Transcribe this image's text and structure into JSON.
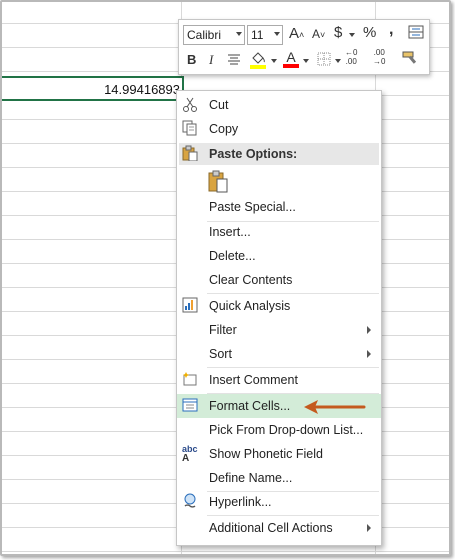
{
  "cell": {
    "value": "14.99416893"
  },
  "toolbar": {
    "font_name": "Calibri",
    "font_size": "11",
    "grow_font": "A",
    "shrink_font": "A",
    "currency": "$",
    "percent": "%",
    "comma": ",",
    "bold": "B",
    "italic": "I",
    "font_color_letter": "A",
    "font_color": "#ff0000",
    "fill_color": "#ffff00",
    "increase_decimal": ".00",
    "decrease_decimal": ".00"
  },
  "menu": {
    "cut": "Cut",
    "copy": "Copy",
    "paste_options": "Paste Options:",
    "paste_special": "Paste Special...",
    "insert": "Insert...",
    "delete": "Delete...",
    "clear_contents": "Clear Contents",
    "quick_analysis": "Quick Analysis",
    "filter": "Filter",
    "sort": "Sort",
    "insert_comment": "Insert Comment",
    "format_cells": "Format Cells...",
    "pick_dropdown": "Pick From Drop-down List...",
    "show_phonetic": "Show Phonetic Field",
    "define_name": "Define Name...",
    "hyperlink": "Hyperlink...",
    "additional_actions": "Additional Cell Actions",
    "phonetic_icon_text": "abc"
  },
  "colors": {
    "highlight": "#d3ecd8",
    "accent": "#217346",
    "arrow": "#c45a1e"
  }
}
